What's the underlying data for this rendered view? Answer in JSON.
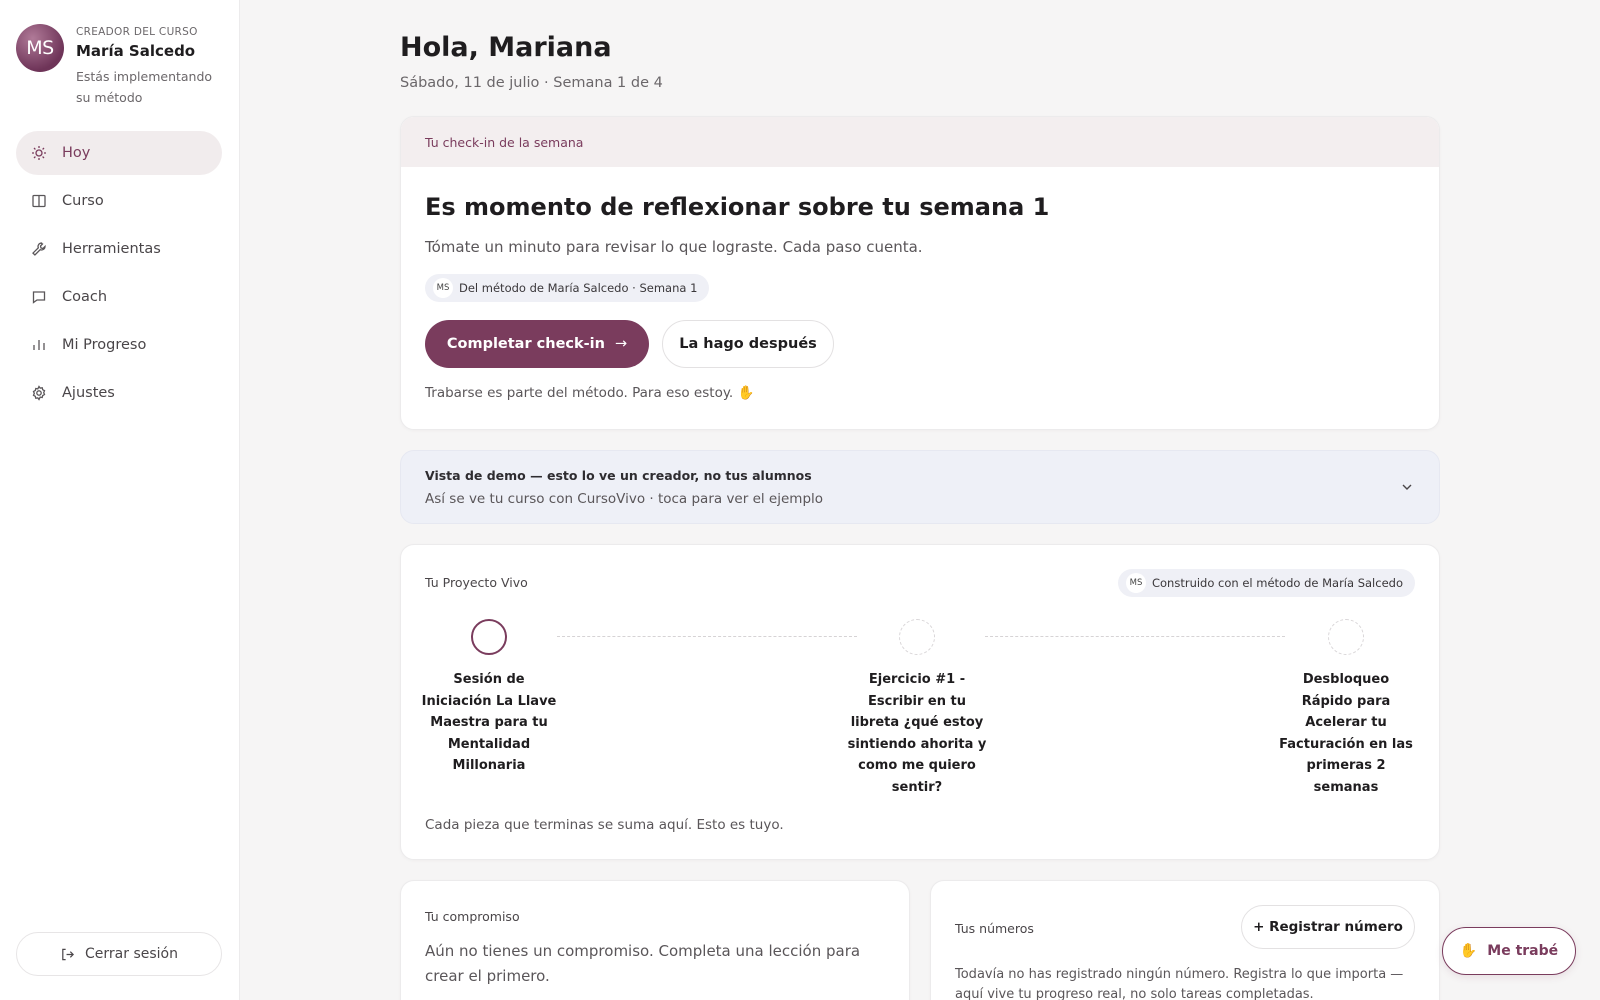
{
  "profile": {
    "initials": "MS",
    "role": "CREADOR DEL CURSO",
    "name": "María Salcedo",
    "description": "Estás implementando su método"
  },
  "nav": {
    "items": [
      {
        "label": "Hoy",
        "icon": "sun-icon",
        "active": true
      },
      {
        "label": "Curso",
        "icon": "book-icon"
      },
      {
        "label": "Herramientas",
        "icon": "wrench-icon"
      },
      {
        "label": "Coach",
        "icon": "chat-icon"
      },
      {
        "label": "Mi Progreso",
        "icon": "bar-chart-icon"
      },
      {
        "label": "Ajustes",
        "icon": "gear-icon"
      }
    ],
    "logout_label": "Cerrar sesión"
  },
  "header": {
    "greeting": "Hola, Mariana",
    "date_line": "Sábado, 11 de julio · Semana 1 de 4"
  },
  "checkin": {
    "header": "Tu check-in de la semana",
    "title": "Es momento de reflexionar sobre tu semana 1",
    "text": "Tómate un minuto para revisar lo que lograste. Cada paso cuenta.",
    "source_badge_initials": "MS",
    "source_badge": "Del método de María Salcedo · Semana 1",
    "primary_label": "Completar check-in",
    "secondary_label": "La hago después",
    "footer": "Trabarse es parte del método. Para eso estoy. ✋"
  },
  "demo": {
    "title": "Vista de demo — esto lo ve un creador, no tus alumnos",
    "subtitle": "Así se ve tu curso con CursoVivo · toca para ver el ejemplo"
  },
  "project": {
    "label": "Tu Proyecto Vivo",
    "built_badge_initials": "MS",
    "built_badge": "Construido con el método de María Salcedo",
    "steps": [
      {
        "label": "Sesión de Iniciación La Llave Maestra para tu Mentalidad Millonaria",
        "status": "current"
      },
      {
        "label": "Ejercicio #1 - Escribir en tu libreta ¿qué estoy sintiendo ahorita y como me quiero sentir?",
        "status": "pending"
      },
      {
        "label": "Desbloqueo Rápido para Acelerar tu Facturación en las primeras 2 semanas",
        "status": "pending"
      }
    ],
    "footer": "Cada pieza que terminas se suma aquí. Esto es tuyo."
  },
  "commitment": {
    "label": "Tu compromiso",
    "text": "Aún no tienes un compromiso. Completa una lección para crear el primero."
  },
  "numbers": {
    "label": "Tus números",
    "register_label": "+ Registrar número",
    "text": "Todavía no has registrado ningún número. Registra lo que importa — aquí vive tu progreso real, no solo tareas completadas."
  },
  "fab": {
    "label": "Me trabé",
    "icon": "raised-hand-icon"
  },
  "colors": {
    "accent": "#7a3c5d",
    "background": "#f6f5f5",
    "demo_background": "#eef0f7"
  }
}
